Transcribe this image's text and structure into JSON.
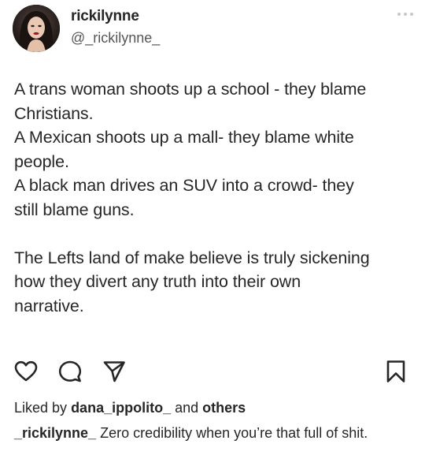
{
  "post": {
    "author": {
      "display_name": "rickilynne",
      "handle": "@_rickilynne_"
    },
    "text_lines": [
      "A trans woman shoots up a school - they blame",
      "Christians.",
      "A Mexican shoots up a mall- they blame white",
      "people.",
      "A black man drives an SUV into a crowd- they",
      "still blame guns.",
      "",
      "The Lefts land of make believe is truly sickening",
      "how they divert any truth into their own",
      "narrative."
    ]
  },
  "icons": {
    "avatar": "profile-photo",
    "more": "more-horizontal-icon",
    "like": "heart-icon",
    "comment": "comment-bubble-icon",
    "share": "send-paper-plane-icon",
    "save": "bookmark-icon"
  },
  "likes": {
    "prefix": "Liked by",
    "user": "dana_ippolito_",
    "joiner": "and",
    "others": "others"
  },
  "comment": {
    "user": "_rickilynne_",
    "text": "Zero credibility when you’re that full of shit."
  }
}
